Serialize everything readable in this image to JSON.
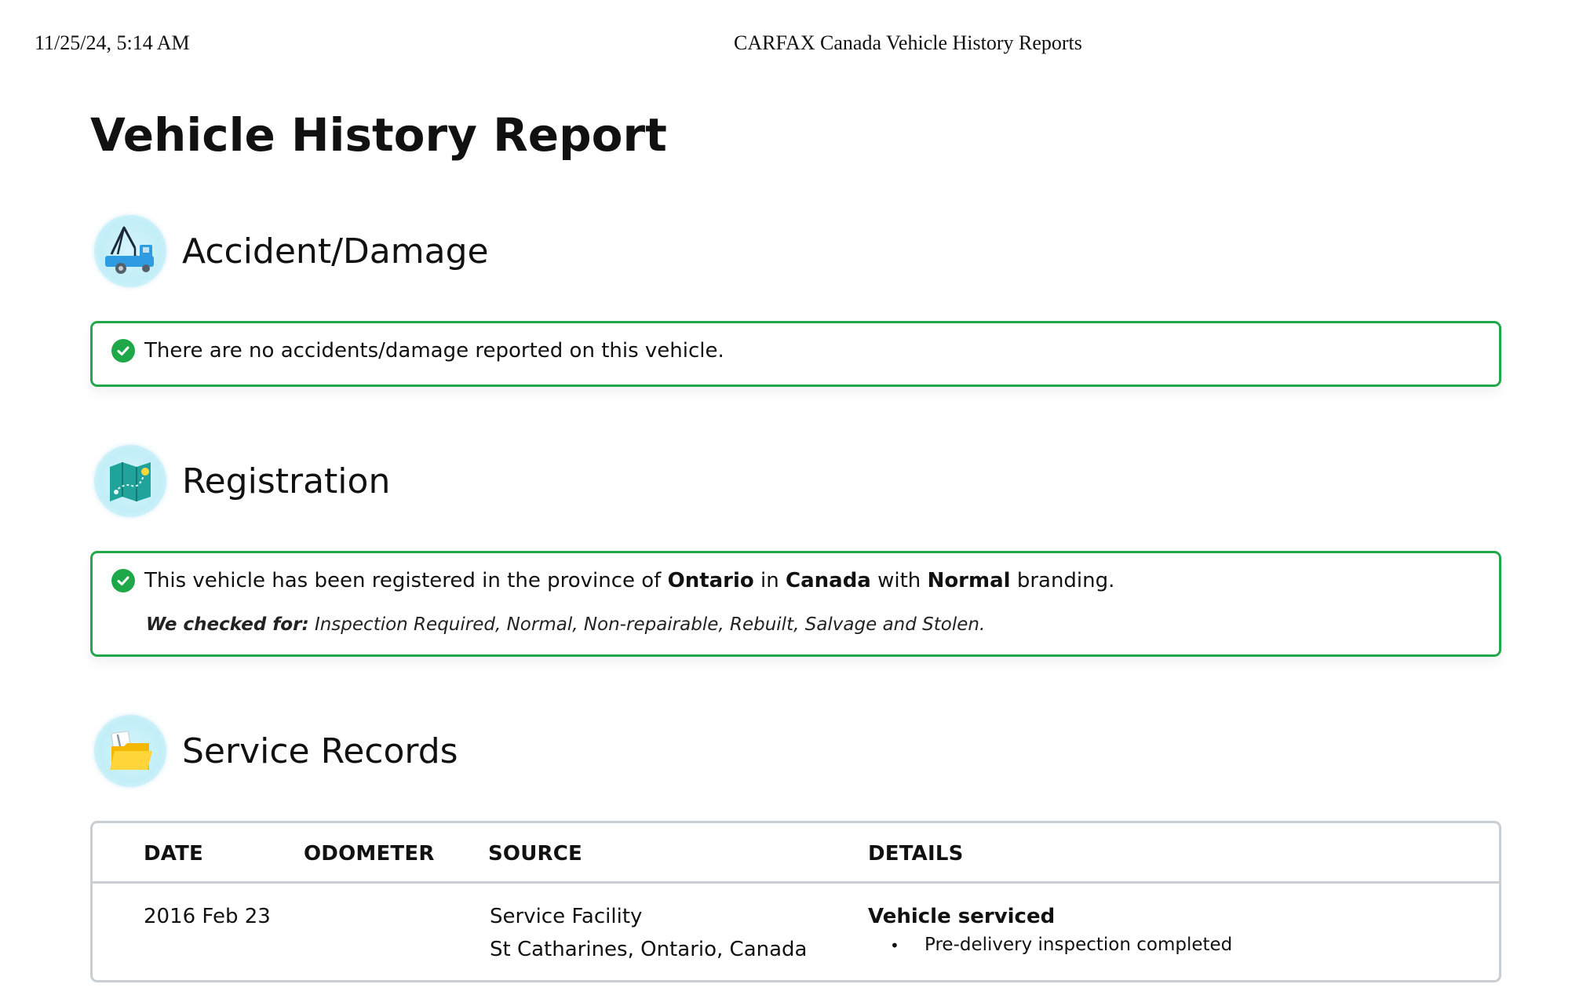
{
  "print_header": {
    "datetime": "11/25/24, 5:14 AM",
    "site_title": "CARFAX Canada Vehicle History Reports"
  },
  "report": {
    "title": "Vehicle History Report"
  },
  "accident": {
    "icon": "tow-truck-icon",
    "title": "Accident/Damage",
    "status_text": "There are no accidents/damage reported on this vehicle."
  },
  "registration": {
    "icon": "map-icon",
    "title": "Registration",
    "status_prefix": "This vehicle has been registered in the province of ",
    "province": "Ontario",
    "status_mid1": " in ",
    "country": "Canada",
    "status_mid2": " with ",
    "branding": "Normal",
    "status_suffix": " branding.",
    "checked_for_label": "We checked for:",
    "checked_for_list": " Inspection Required, Normal, Non-repairable, Rebuilt, Salvage and Stolen."
  },
  "service": {
    "icon": "folder-icon",
    "title": "Service Records",
    "columns": [
      "DATE",
      "ODOMETER",
      "SOURCE",
      "DETAILS"
    ],
    "rows": [
      {
        "date": "2016 Feb 23",
        "odometer": "",
        "source_line1": "Service Facility",
        "source_line2": "St Catharines, Ontario, Canada",
        "detail_title": "Vehicle serviced",
        "detail_items": [
          "Pre-delivery inspection completed"
        ]
      }
    ]
  },
  "colors": {
    "success_green": "#22a84a",
    "table_border": "#c9cdd4",
    "icon_bg": "#c2eef8"
  }
}
